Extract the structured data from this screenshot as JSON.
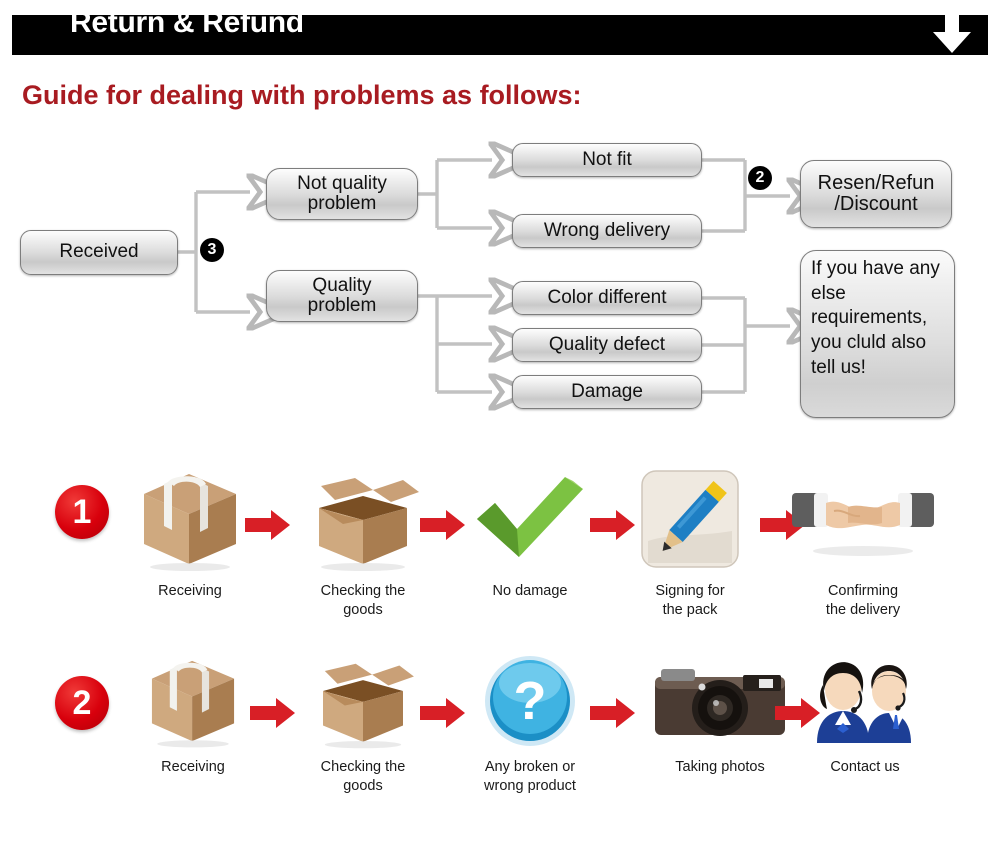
{
  "header": {
    "title": "Return & Refund",
    "arrow_icon": "down-arrow-icon",
    "background_color": "#000000",
    "text_color": "#ffffff"
  },
  "guide": {
    "heading": "Guide for dealing with problems as follows:",
    "color": "#a81b21"
  },
  "flowchart": {
    "markers": {
      "stage3": "3",
      "stage2": "2"
    },
    "boxes": {
      "received": "Received",
      "not_quality_problem": "Not quality\nproblem",
      "quality_problem": "Quality\nproblem",
      "not_fit": "Not fit",
      "wrong_delivery": "Wrong delivery",
      "color_different": "Color different",
      "quality_defect": "Quality defect",
      "damage": "Damage",
      "resend_refund": "Resen/Refun\n/Discount",
      "note": "If you have any else requirements, you cluld also tell us!"
    }
  },
  "process": {
    "rows": [
      {
        "number": "1",
        "steps": [
          {
            "icon": "sealed-box-icon",
            "label": "Receiving"
          },
          {
            "icon": "open-box-icon",
            "label": "Checking the\ngoods"
          },
          {
            "icon": "green-check-icon",
            "label": "No damage"
          },
          {
            "icon": "pencil-signing-icon",
            "label": "Signing for\nthe pack"
          },
          {
            "icon": "handshake-icon",
            "label": "Confirming\nthe delivery"
          }
        ]
      },
      {
        "number": "2",
        "steps": [
          {
            "icon": "sealed-box-icon",
            "label": "Receiving"
          },
          {
            "icon": "open-box-icon",
            "label": "Checking the\ngoods"
          },
          {
            "icon": "blue-question-icon",
            "label": "Any broken or\nwrong product"
          },
          {
            "icon": "camera-icon",
            "label": "Taking photos"
          },
          {
            "icon": "support-agents-icon",
            "label": "Contact us"
          }
        ]
      }
    ],
    "arrow_icon": "red-right-arrow-icon",
    "arrow_color": "#d81f26"
  }
}
